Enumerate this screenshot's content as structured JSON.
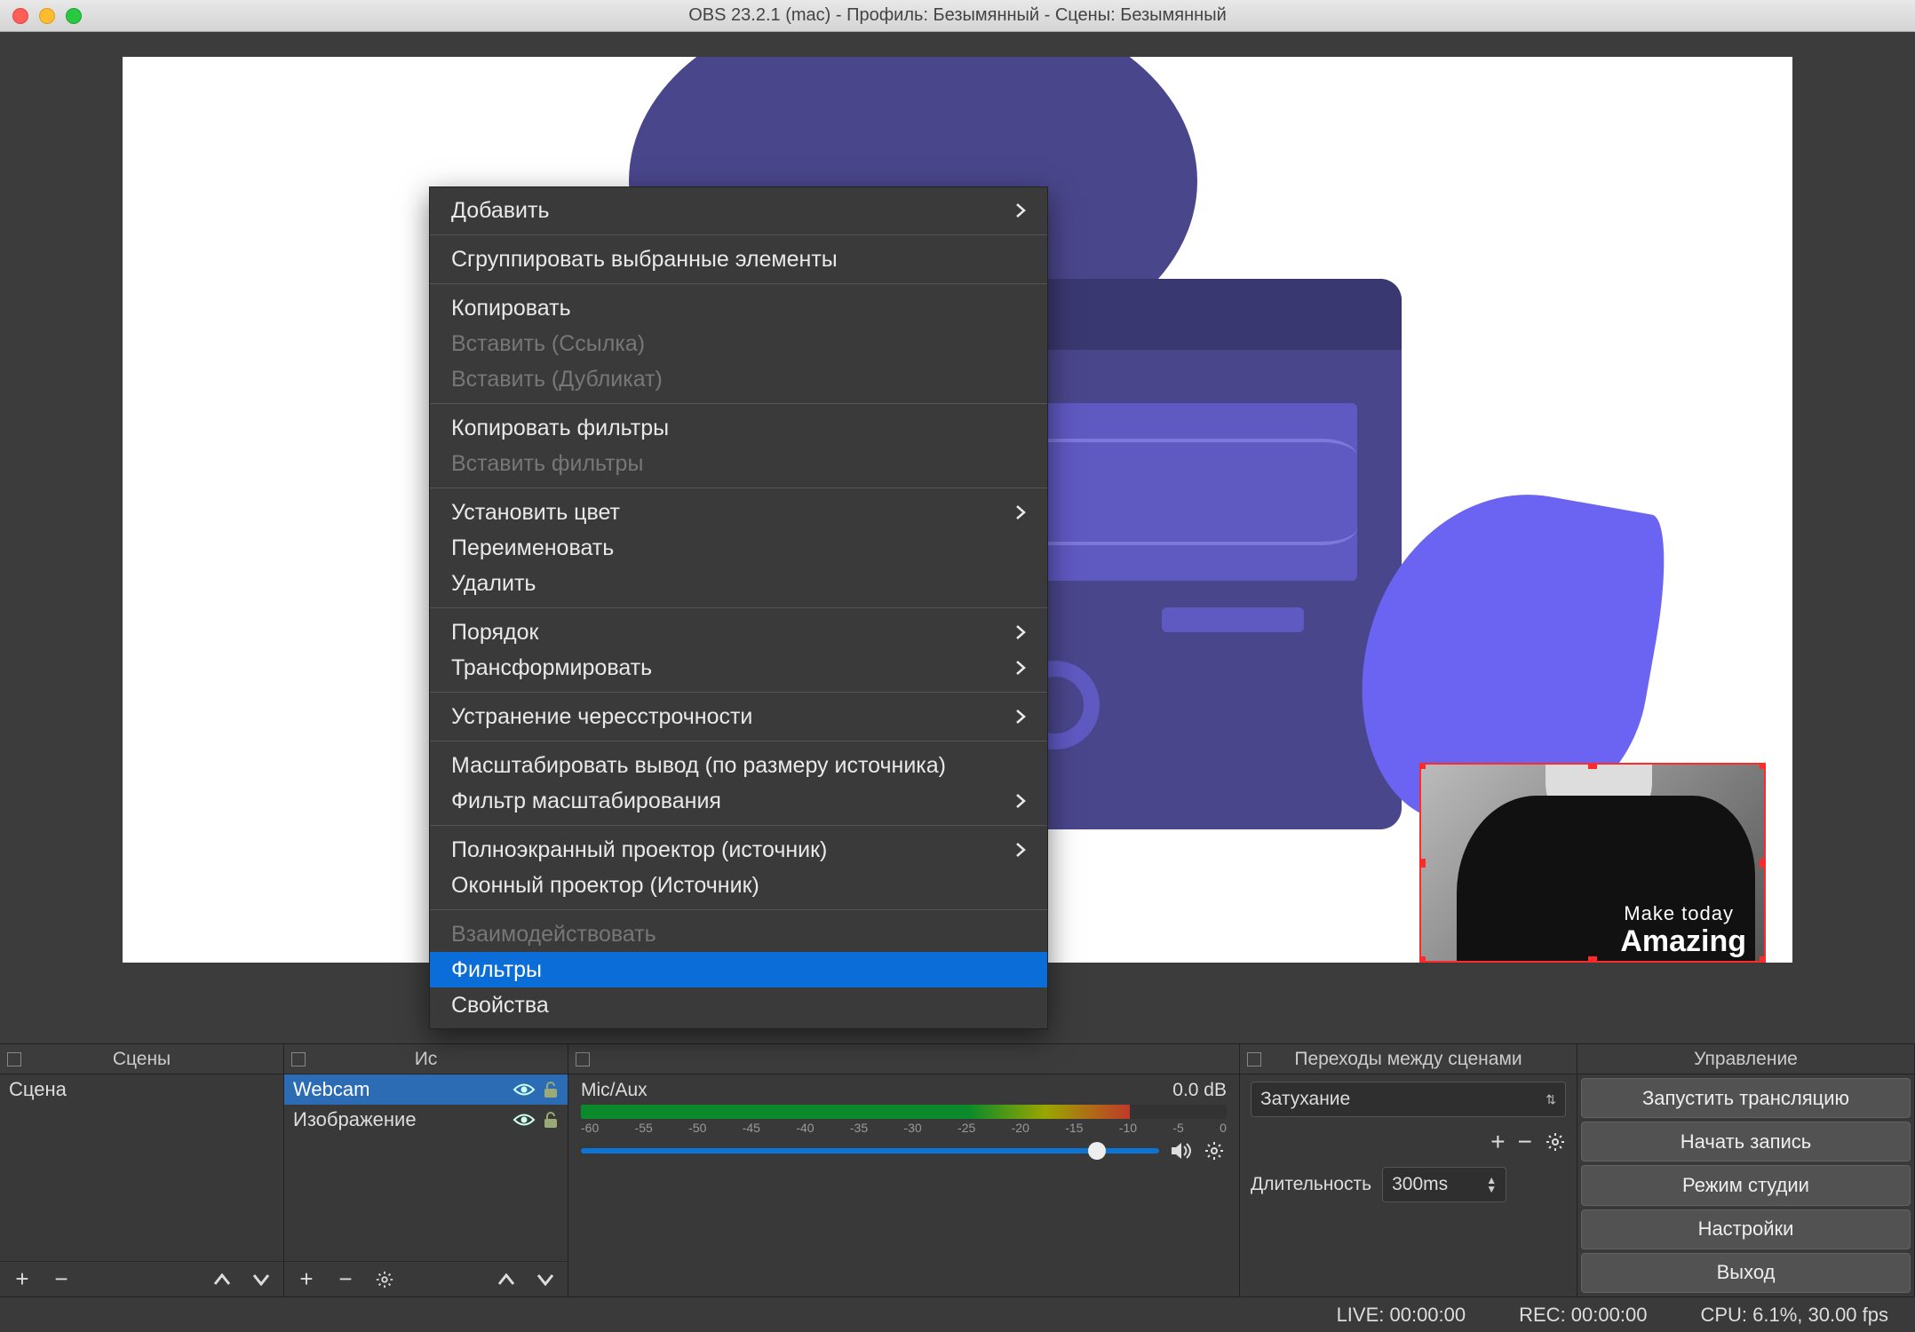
{
  "titlebar": {
    "title": "OBS 23.2.1 (mac) - Профиль: Безымянный - Сцены: Безымянный"
  },
  "context_menu": {
    "items": [
      {
        "label": "Добавить",
        "submenu": true
      },
      {
        "sep": true
      },
      {
        "label": "Сгруппировать выбранные элементы"
      },
      {
        "sep": true
      },
      {
        "label": "Копировать"
      },
      {
        "label": "Вставить (Ссылка)",
        "disabled": true
      },
      {
        "label": "Вставить (Дубликат)",
        "disabled": true
      },
      {
        "sep": true
      },
      {
        "label": "Копировать фильтры"
      },
      {
        "label": "Вставить фильтры",
        "disabled": true
      },
      {
        "sep": true
      },
      {
        "label": "Установить цвет",
        "submenu": true
      },
      {
        "label": "Переименовать"
      },
      {
        "label": "Удалить"
      },
      {
        "sep": true
      },
      {
        "label": "Порядок",
        "submenu": true
      },
      {
        "label": "Трансформировать",
        "submenu": true
      },
      {
        "sep": true
      },
      {
        "label": "Устранение чересстрочности",
        "submenu": true
      },
      {
        "sep": true
      },
      {
        "label": "Масштабировать вывод (по размеру источника)"
      },
      {
        "label": "Фильтр масштабирования",
        "submenu": true
      },
      {
        "sep": true
      },
      {
        "label": "Полноэкранный проектор (источник)",
        "submenu": true
      },
      {
        "label": "Оконный проектор (Источник)"
      },
      {
        "sep": true
      },
      {
        "label": "Взаимодействовать",
        "disabled": true
      },
      {
        "label": "Фильтры",
        "highlight": true
      },
      {
        "label": "Свойства"
      }
    ]
  },
  "panels": {
    "scenes": {
      "title": "Сцены",
      "items": [
        "Сцена"
      ]
    },
    "sources": {
      "title": "Ис",
      "items": [
        {
          "name": "Webcam",
          "selected": true,
          "visible": true,
          "locked": false
        },
        {
          "name": "Изображение",
          "selected": false,
          "visible": true,
          "locked": false
        }
      ]
    },
    "mixer": {
      "title": "",
      "tracks": [
        {
          "name": "Mic/Aux",
          "level_db": "0.0 dB",
          "ticks": [
            "-60",
            "-55",
            "-50",
            "-45",
            "-40",
            "-35",
            "-30",
            "-25",
            "-20",
            "-15",
            "-10",
            "-5",
            "0"
          ]
        }
      ]
    },
    "transitions": {
      "title": "Переходы между сценами",
      "selected": "Затухание",
      "duration_label": "Длительность",
      "duration_value": "300ms"
    },
    "controls": {
      "title": "Управление",
      "buttons": [
        "Запустить трансляцию",
        "Начать запись",
        "Режим студии",
        "Настройки",
        "Выход"
      ]
    }
  },
  "webcam_pip": {
    "text_line1": "Make today",
    "text_line2": "Amazing"
  },
  "statusbar": {
    "live": "LIVE: 00:00:00",
    "rec": "REC: 00:00:00",
    "cpu": "CPU: 6.1%, 30.00 fps"
  }
}
